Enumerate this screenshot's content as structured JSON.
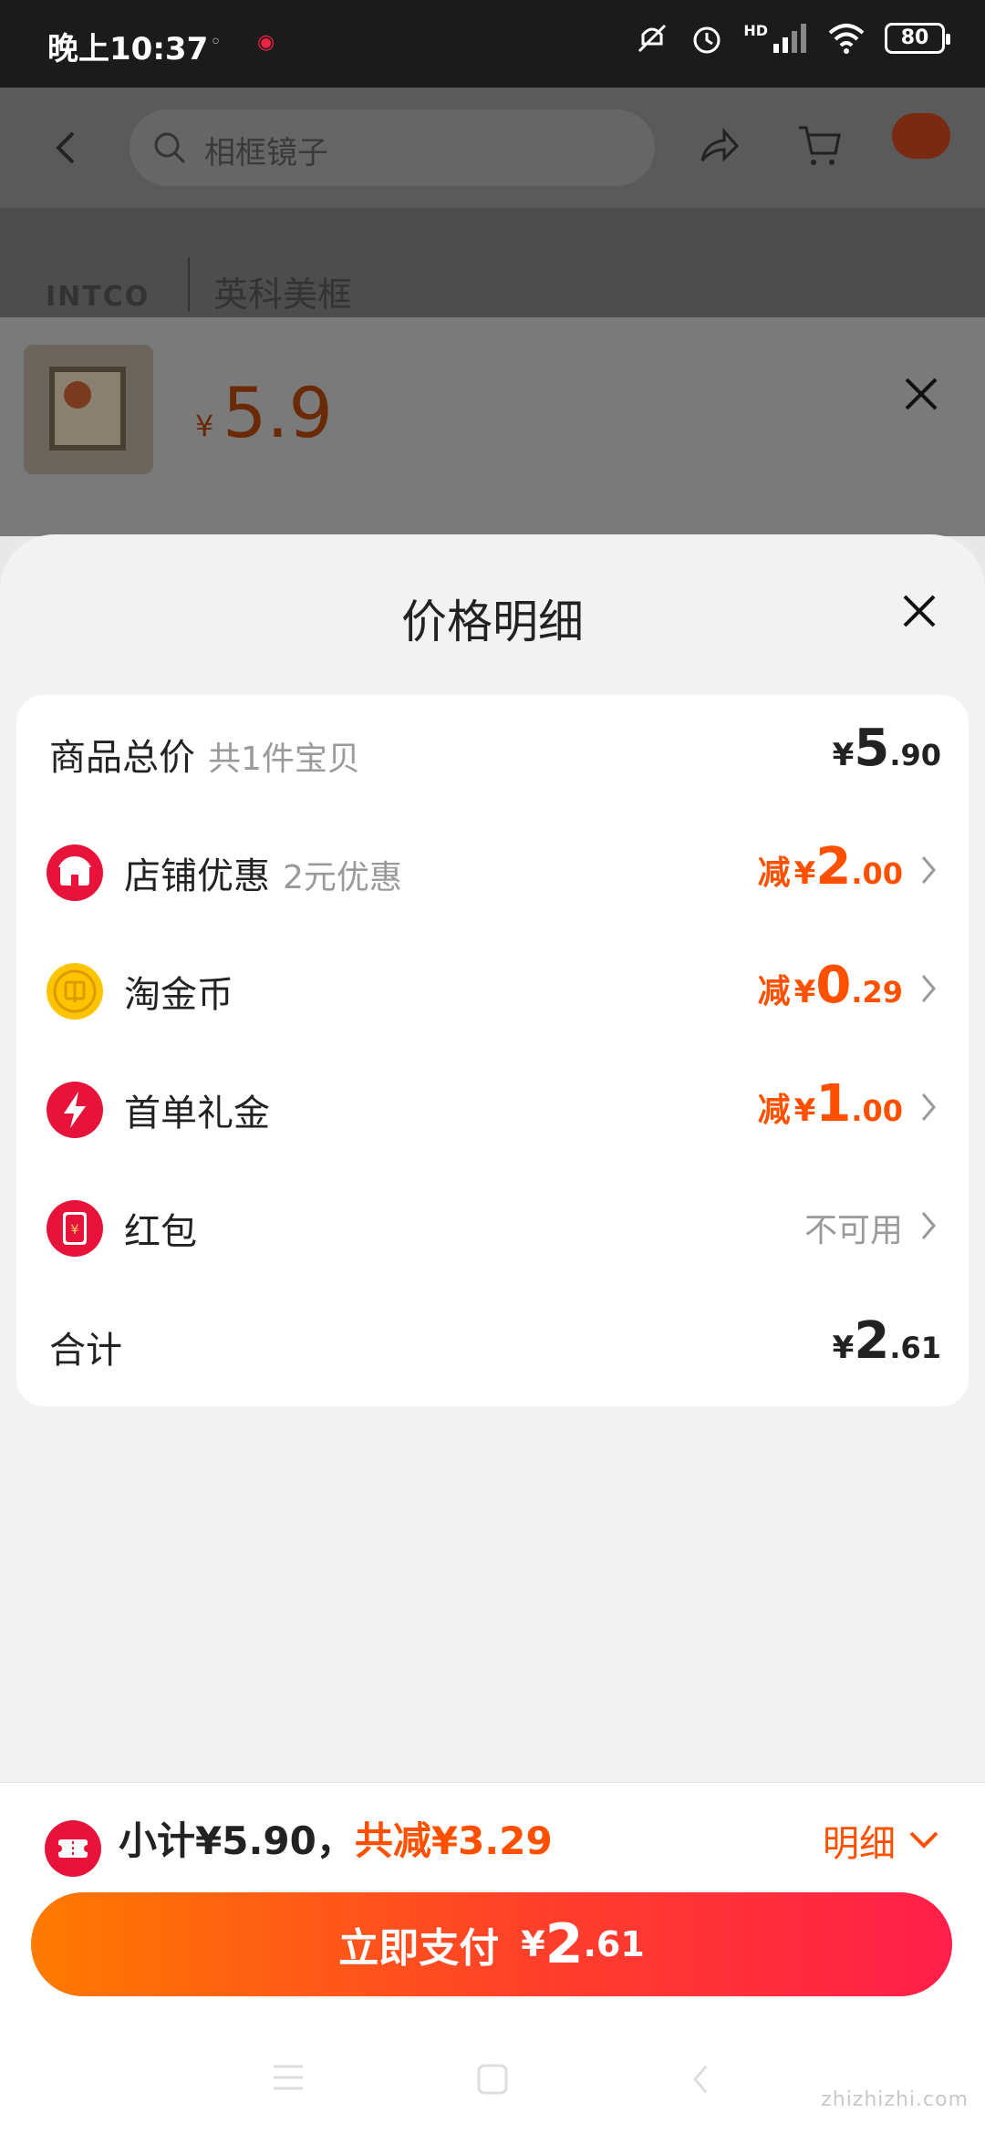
{
  "status_bar": {
    "time": "晚上10:37",
    "notif": "◦ ◉",
    "battery": "80",
    "network_label": "HD"
  },
  "background_page": {
    "search_placeholder": "相框镜子",
    "brand_logo": "INTCO",
    "brand_name": "英科美框",
    "product_currency": "¥",
    "product_price": "5.9"
  },
  "sheet": {
    "title": "价格明细",
    "rows": [
      {
        "label": "商品总价",
        "sub": "共1件宝贝",
        "yen": "¥",
        "big": "5",
        "dec": ".90"
      },
      {
        "label": "店铺优惠",
        "sub": "2元优惠",
        "prefix": "减",
        "yen": "¥",
        "big": "2",
        "dec": ".00"
      },
      {
        "label": "淘金币",
        "prefix": "减",
        "yen": "¥",
        "big": "0",
        "dec": ".29"
      },
      {
        "label": "首单礼金",
        "prefix": "减",
        "yen": "¥",
        "big": "1",
        "dec": ".00"
      },
      {
        "label": "红包",
        "status": "不可用"
      },
      {
        "label": "合计",
        "yen": "¥",
        "big": "2",
        "dec": ".61"
      }
    ]
  },
  "bottom": {
    "subtotal_text": "小计¥5.90，",
    "discount_text": "共减¥3.29",
    "detail_label": "明细",
    "pay_label": "立即支付",
    "pay_yen": "¥",
    "pay_big": "2",
    "pay_dec": ".61"
  },
  "watermark": "zhizhizhi.com",
  "colors": {
    "accent": "#ff5000",
    "pay_gradient_start": "#ff7a00",
    "pay_gradient_end": "#ff1f4a",
    "icon_red": "#e8133a",
    "coin_yellow": "#ffc400"
  }
}
